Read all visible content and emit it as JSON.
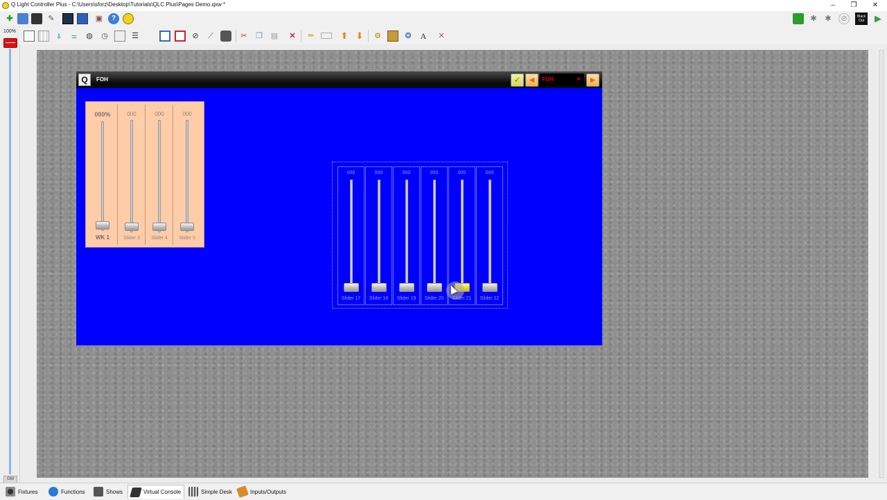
{
  "window": {
    "title": "Q Light Controller Plus - C:\\Users\\sforz\\Desktop\\Tutorials\\QLC Plus\\Pages Demo.qxw *",
    "controls": [
      "–",
      "❐",
      "✕"
    ]
  },
  "grand_master": {
    "value": "100%",
    "label": "GM"
  },
  "toolbar_top": {
    "left_icons": [
      "new-file-icon",
      "save-icon",
      "save-as-icon",
      "open-icon",
      "monitor-icon",
      "dmx-grid-icon",
      "about-icon",
      "help-icon",
      "bulb-icon"
    ],
    "right_icons": [
      "live-edit-icon",
      "stop-functions-icon",
      "fade-icon",
      "disabled-icon",
      "blackout-icon",
      "run-mode-icon"
    ],
    "blackout_label": "Black Out"
  },
  "toolbar_vc": {
    "icons": [
      "button-icon",
      "button-matrix-icon",
      "slider-icon",
      "slider-matrix-icon",
      "knob-icon",
      "speed-dial-icon",
      "xy-pad-icon",
      "cue-list-icon",
      "frame-icon",
      "solo-frame-icon",
      "label-icon",
      "audio-triggers-icon",
      "clock-icon",
      "animation-icon",
      "cut-icon",
      "copy-icon",
      "paste-icon",
      "delete-icon",
      "edit-icon",
      "rename-icon",
      "bring-up-icon",
      "send-down-icon",
      "properties-icon",
      "background-image-icon",
      "font-color-icon",
      "font-icon",
      "tools-icon"
    ]
  },
  "frame": {
    "title": "FOH",
    "page_select": "FOH",
    "buttons": {
      "enable": "✓",
      "prev": "◄",
      "next": "►"
    }
  },
  "cue_frame": {
    "columns": [
      {
        "value": "000%",
        "label": "WK 1",
        "level": 0
      },
      {
        "value": "000",
        "label": "Slider 3",
        "level": 0
      },
      {
        "value": "000",
        "label": "Slider 4",
        "level": 0
      },
      {
        "value": "000",
        "label": "Slider 5",
        "level": 0
      }
    ]
  },
  "solo_frame": {
    "sliders": [
      {
        "value": "000",
        "label": "Slider 17",
        "level": 0
      },
      {
        "value": "000",
        "label": "Slider 18",
        "level": 0
      },
      {
        "value": "000",
        "label": "Slider 19",
        "level": 0
      },
      {
        "value": "000",
        "label": "Slider 20",
        "level": 0
      },
      {
        "value": "000",
        "label": "Slider 21",
        "level": 0
      },
      {
        "value": "000",
        "label": "Slider 22",
        "level": 0
      }
    ]
  },
  "bottom_tabs": [
    {
      "label": "Fixtures",
      "icon": "fixtures-icon",
      "color": "#555555"
    },
    {
      "label": "Functions",
      "icon": "functions-icon",
      "color": "#2a7bd5"
    },
    {
      "label": "Shows",
      "icon": "shows-icon",
      "color": "#444444"
    },
    {
      "label": "Virtual Console",
      "icon": "virtual-console-icon",
      "color": "#333333",
      "active": true
    },
    {
      "label": "Simple Desk",
      "icon": "simple-desk-icon",
      "color": "#555555"
    },
    {
      "label": "Inputs/Outputs",
      "icon": "inputs-outputs-icon",
      "color": "#d98a2a"
    }
  ]
}
